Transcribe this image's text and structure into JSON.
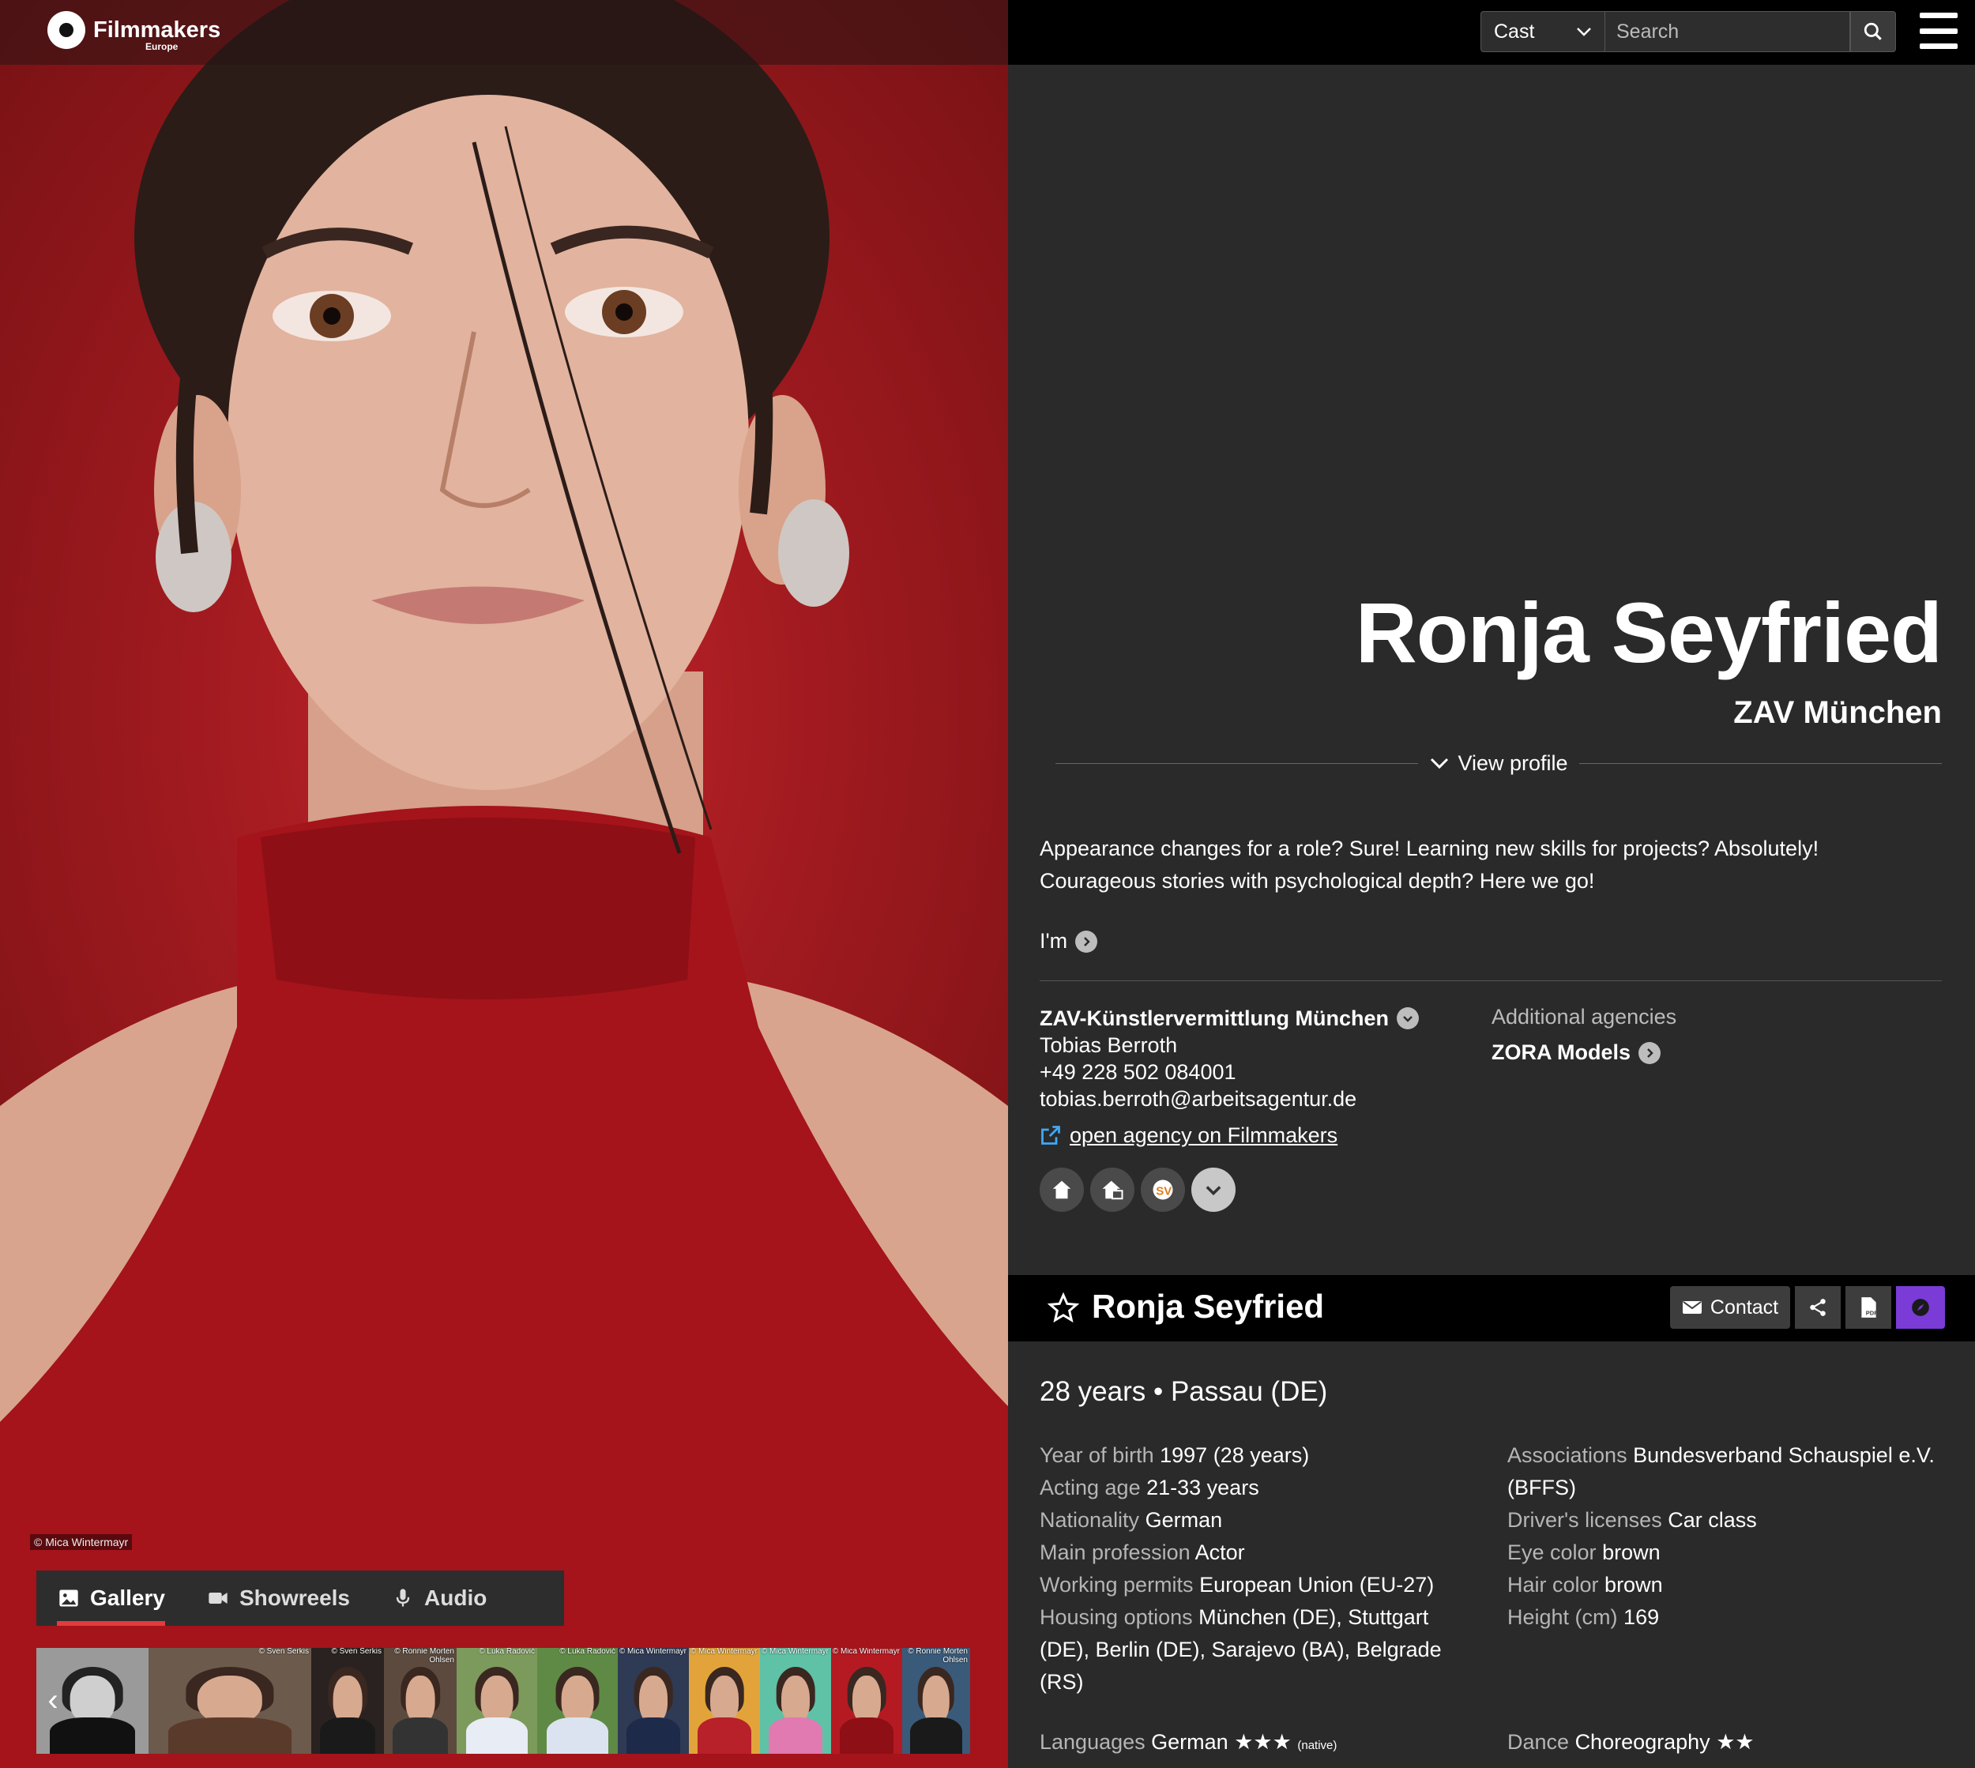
{
  "brand": {
    "name": "Filmmakers",
    "sub": "Europe"
  },
  "header": {
    "category_select": "Cast",
    "search_placeholder": "Search"
  },
  "photo": {
    "credit": "© Mica Wintermayr",
    "tabs": [
      {
        "label": "Gallery",
        "icon": "image-icon",
        "active": true
      },
      {
        "label": "Showreels",
        "icon": "video-camera-icon",
        "active": false
      },
      {
        "label": "Audio",
        "icon": "microphone-icon",
        "active": false
      }
    ],
    "thumbnails": [
      {
        "credit": ""
      },
      {
        "credit": "© Sven Serkis"
      },
      {
        "credit": "© Sven Serkis"
      },
      {
        "credit": "© Ronnie Morten Ohlsen"
      },
      {
        "credit": "© Luka Radović"
      },
      {
        "credit": "© Luka Radović"
      },
      {
        "credit": "© Mica Wintermayr"
      },
      {
        "credit": "© Mica Wintermayr"
      },
      {
        "credit": "© Mica Wintermayr"
      },
      {
        "credit": "© Mica Wintermayr"
      },
      {
        "credit": "© Ronnie Morten Ohlsen"
      }
    ]
  },
  "profile": {
    "name": "Ronja Seyfried",
    "agency_short": "ZAV München",
    "view_profile": "View profile",
    "bio": "Appearance changes for a role? Sure! Learning new skills for projects? Absolutely! Courageous stories with psychological depth? Here we go!",
    "im_label": "I'm"
  },
  "agency": {
    "name": "ZAV-Künstlervermittlung München",
    "contact": "Tobias Berroth",
    "phone": "+49 228 502 084001",
    "email": "tobias.berroth@arbeitsagentur.de",
    "link": "open agency on Filmmakers",
    "additional_label": "Additional agencies",
    "additional": "ZORA Models"
  },
  "sticky": {
    "name": "Ronja Seyfried",
    "contact": "Contact"
  },
  "summary": "28 years • Passau (DE)",
  "facts_left": [
    {
      "k": "Year of birth",
      "v": "1997 (28 years)"
    },
    {
      "k": "Acting age",
      "v": "21-33 years"
    },
    {
      "k": "Nationality",
      "v": "German"
    },
    {
      "k": "Main profession",
      "v": "Actor"
    },
    {
      "k": "Working permits",
      "v": "European Union (EU-27)"
    },
    {
      "k": "Housing options",
      "v": "München (DE), Stuttgart (DE), Berlin (DE), Sarajevo (BA), Belgrade (RS)"
    }
  ],
  "facts_right": [
    {
      "k": "Associations",
      "v": "Bundesverband Schauspiel e.V. (BFFS)"
    },
    {
      "k": "Driver's licenses",
      "v": "Car class"
    },
    {
      "k": "Eye color",
      "v": "brown"
    },
    {
      "k": "Hair color",
      "v": "brown"
    },
    {
      "k": "Height (cm)",
      "v": "169"
    }
  ],
  "languages": {
    "k": "Languages",
    "v": "German",
    "stars": "★★★",
    "note": "(native)"
  },
  "dance": {
    "k": "Dance",
    "v": "Choreography",
    "stars": "★★"
  }
}
